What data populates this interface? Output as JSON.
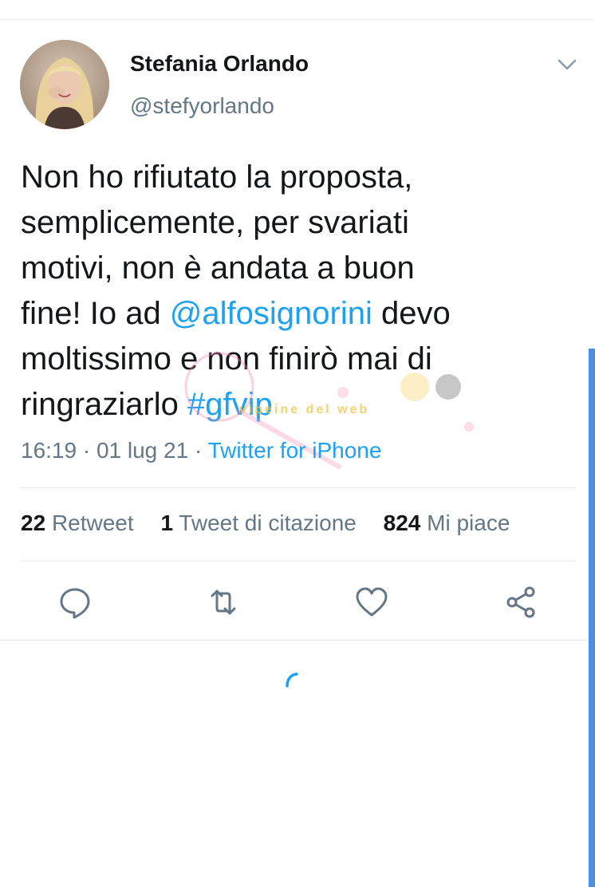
{
  "tweet": {
    "author_name": "Stefania Orlando",
    "author_handle": "@stefyorlando",
    "text_lines": [
      "Non ho rifiutato la proposta,",
      "semplicemente, per svariati",
      "motivi, non è andata a buon"
    ],
    "line4_prefix": "fine! Io ad ",
    "mention": "@alfosignorini",
    "line4_suffix": " devo",
    "line5": "moltissimo e non finirò mai di",
    "line6_prefix": "ringraziarlo ",
    "hashtag": "#gfvip",
    "time": "16:19",
    "date": "01 lug 21",
    "separator": "·",
    "source": "Twitter for iPhone"
  },
  "stats": {
    "retweets_count": "22",
    "retweets_label": "Retweet",
    "quotes_count": "1",
    "quotes_label": "Tweet di citazione",
    "likes_count": "824",
    "likes_label": "Mi piace"
  },
  "watermark": {
    "text": "vipeine del web"
  },
  "icons": {
    "reply": "reply-icon",
    "retweet": "retweet-icon",
    "like": "heart-icon",
    "share": "share-icon",
    "caret": "chevron-down-icon",
    "loading": "loading-spinner-icon"
  },
  "colors": {
    "accent": "#1da1f2",
    "text": "#14171a",
    "secondary": "#657786",
    "divider": "#e6ecf0"
  }
}
